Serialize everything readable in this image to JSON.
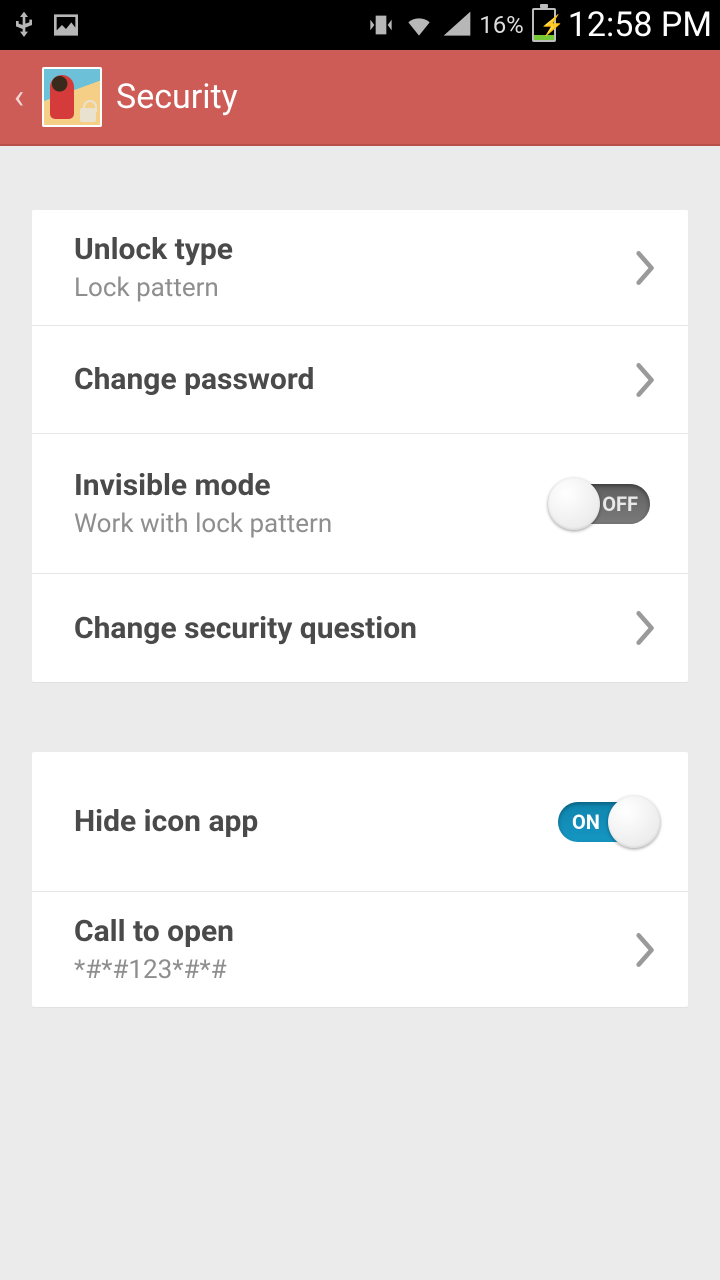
{
  "status": {
    "battery_pct": "16%",
    "time": "12:58 PM"
  },
  "header": {
    "title": "Security"
  },
  "group1": {
    "unlock": {
      "title": "Unlock type",
      "sub": "Lock pattern"
    },
    "change_pw": {
      "title": "Change password"
    },
    "invisible": {
      "title": "Invisible mode",
      "sub": "Work with lock pattern",
      "toggle_label": "OFF"
    },
    "secq": {
      "title": "Change security question"
    }
  },
  "group2": {
    "hide_icon": {
      "title": "Hide icon app",
      "toggle_label": "ON"
    },
    "call_open": {
      "title": "Call to open",
      "sub": "*#*#123*#*#"
    }
  }
}
